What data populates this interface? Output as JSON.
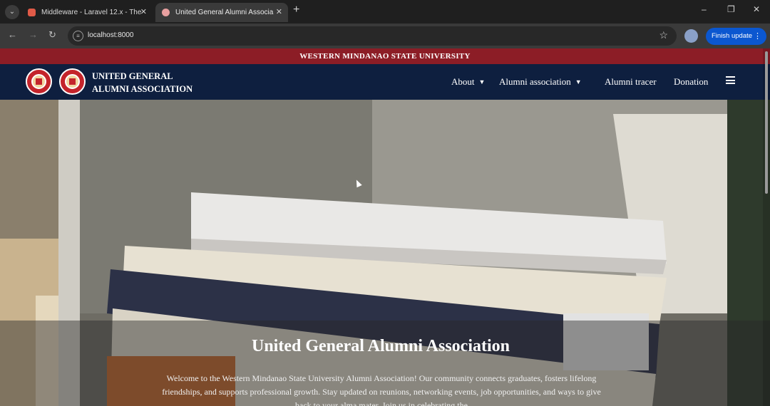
{
  "browser": {
    "tabs": [
      {
        "title": "Middleware - Laravel 12.x - The",
        "active": false,
        "favicon_color": "#e05a47"
      },
      {
        "title": "United General Alumni Associa",
        "active": true,
        "favicon_color": "#e8a0a0"
      }
    ],
    "new_tab": "+",
    "window_controls": {
      "minimize": "–",
      "maximize": "❐",
      "close": "✕"
    },
    "url": "localhost:8000",
    "update_button": "Finish update",
    "icons": [
      "back-icon",
      "forward-icon",
      "reload-icon",
      "site-info-icon",
      "bookmark-star-icon",
      "profile-icon",
      "more-icon"
    ]
  },
  "site": {
    "top_strip": "WESTERN MINDANAO STATE UNIVERSITY",
    "brand_line1": "UNITED GENERAL",
    "brand_line2": "ALUMNI ASSOCIATION",
    "nav": {
      "about": "About",
      "alumni_association": "Alumni association",
      "alumni_tracer": "Alumni tracer",
      "donation": "Donation"
    },
    "colors": {
      "strip": "#8c1d26",
      "nav": "#0e1f3f",
      "logo": "#c4242b"
    }
  },
  "hero": {
    "title": "United General Alumni Association",
    "text": "Welcome to the Western Mindanao State University Alumni Association! Our community connects graduates, fosters lifelong friendships, and supports professional growth. Stay updated on reunions, networking events, job opportunities, and ways to give back to your alma mater. Join us in celebrating the"
  }
}
